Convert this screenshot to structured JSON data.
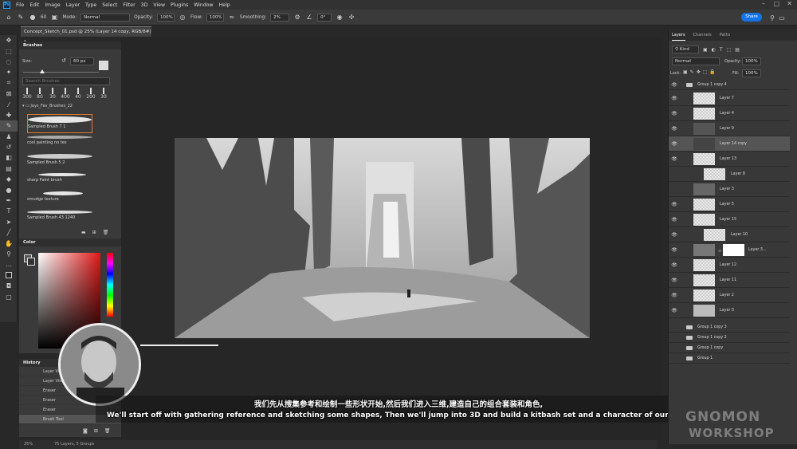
{
  "menubar": {
    "logo": "Ps",
    "items": [
      "File",
      "Edit",
      "Image",
      "Layer",
      "Type",
      "Select",
      "Filter",
      "3D",
      "View",
      "Plugins",
      "Window",
      "Help"
    ]
  },
  "options": {
    "mode_label": "Mode:",
    "mode_value": "Normal",
    "opacity_label": "Opacity:",
    "opacity_value": "100%",
    "flow_label": "Flow:",
    "flow_value": "100%",
    "smoothing_label": "Smoothing:",
    "smoothing_value": "2%",
    "angle_value": "0°",
    "size_value": "60",
    "share_label": "Share"
  },
  "document": {
    "tab_title": "Concept_Sketch_01.psd @ 25% (Layer 14 copy, RGB/8#) *"
  },
  "brushes": {
    "title": "Brushes",
    "size_label": "Size:",
    "size_value": "60 px",
    "search_placeholder": "Search Brushes",
    "presets": [
      "300",
      "80",
      "30",
      "400",
      "40",
      "200",
      "30"
    ],
    "folder": "Jays_Fav_Brushes_22",
    "items": [
      "Sampled Brush 7 1",
      "cool painting no tex",
      "Sampled Brush 5 2",
      "sharp Paint brush",
      "smudge texture",
      "Sampled Brush 43 1240"
    ]
  },
  "color": {
    "title": "Color"
  },
  "history": {
    "title": "History",
    "items": [
      "Layer Visibility",
      "Layer Visibility",
      "Eraser",
      "Eraser",
      "Eraser",
      "Brush Tool"
    ]
  },
  "status": {
    "zoom": "25%",
    "info": "75 Layers, 5 Groups"
  },
  "subtitles": {
    "cn": "我们先从搜集参考和绘制一些形状开始,然后我们进入三维,建造自己的组合套装和角色,",
    "en": "We'll start off with gathering reference and sketching some shapes, Then we'll jump into 3D and build a kitbash set and a character of our own,"
  },
  "layers_panel": {
    "tabs": [
      "Layers",
      "Channels",
      "Paths"
    ],
    "kind_label": "Kind",
    "blend": "Normal",
    "opacity_label": "Opacity:",
    "opacity_value": "100%",
    "lock_label": "Lock:",
    "fill_label": "Fill:",
    "fill_value": "100%",
    "group_open": "Group 1 copy 4",
    "layers": [
      "Layer 7",
      "Layer 4",
      "Layer 9",
      "Layer 14 copy",
      "Layer 13",
      "Layer 8",
      "Layer 3",
      "Layer 5",
      "Layer 15",
      "Layer 10",
      "Layer 3...",
      "Layer 12",
      "Layer 11",
      "Layer 2",
      "Layer 0"
    ],
    "groups": [
      "Group 1 copy 3",
      "Group 1 copy 2",
      "Group 1 copy",
      "Group 1"
    ]
  },
  "watermark": {
    "line1": "GNOMON",
    "line2": "WORKSHOP"
  }
}
